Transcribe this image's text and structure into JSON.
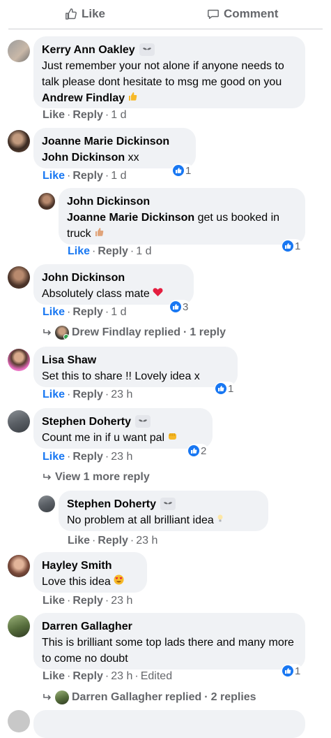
{
  "top_actions": {
    "like": "Like",
    "comment": "Comment"
  },
  "comments": [
    {
      "id": "c1",
      "author": "Kerry Ann Oakley",
      "has_badge": true,
      "text_before": "Just remember your not alone if anyone needs to talk please dont hesitate to msg me good on you ",
      "mention": "Andrew Findlay",
      "emoji": "thumbs-up",
      "like": "Like",
      "reply": "Reply",
      "time": "1 d"
    },
    {
      "id": "c2",
      "author": "Joanne Marie Dickinson",
      "mention": "John Dickinson",
      "text_after": " xx",
      "like": "Like",
      "reply": "Reply",
      "time": "1 d",
      "reactions": "1"
    },
    {
      "id": "c3",
      "author": "John Dickinson",
      "mention": "Joanne Marie Dickinson",
      "text_after": " get us booked in truck",
      "emoji": "thumbs-up",
      "like": "Like",
      "reply": "Reply",
      "time": "1 d",
      "reactions": "1"
    },
    {
      "id": "c4",
      "author": "John Dickinson",
      "text": "Absolutely class mate",
      "emoji": "heart",
      "like": "Like",
      "reply": "Reply",
      "time": "1 d",
      "reactions": "3",
      "replies_summary": {
        "name": "Drew Findlay",
        "replied": "replied",
        "count": "1 reply"
      }
    },
    {
      "id": "c5",
      "author": "Lisa Shaw",
      "text": "Set this to share !! Lovely idea x",
      "like": "Like",
      "reply": "Reply",
      "time": "23 h",
      "reactions": "1"
    },
    {
      "id": "c6",
      "author": "Stephen Doherty",
      "has_badge": true,
      "text": "Count me in if u want pal",
      "emoji": "fist",
      "like": "Like",
      "reply": "Reply",
      "time": "23 h",
      "reactions": "2",
      "view_more": "View 1 more reply"
    },
    {
      "id": "c7",
      "author": "Stephen Doherty",
      "has_badge": true,
      "text": "No problem at all brilliant idea",
      "emoji": "bulb",
      "like": "Like",
      "reply": "Reply",
      "time": "23 h"
    },
    {
      "id": "c8",
      "author": "Hayley Smith",
      "text": "Love this idea",
      "emoji": "heart-eyes",
      "like": "Like",
      "reply": "Reply",
      "time": "23 h"
    },
    {
      "id": "c9",
      "author": "Darren Gallagher",
      "text": "This is brilliant some top lads there and many more to come no doubt",
      "like": "Like",
      "reply": "Reply",
      "time": "23 h",
      "edited": "Edited",
      "reactions": "1",
      "replies_summary": {
        "name": "Darren Gallagher",
        "replied": "replied",
        "count": "2 replies"
      }
    }
  ],
  "separator": "·",
  "colors": {
    "accent": "#1877f2",
    "bubble": "#f0f2f5",
    "muted": "#65676b",
    "text": "#050505"
  }
}
